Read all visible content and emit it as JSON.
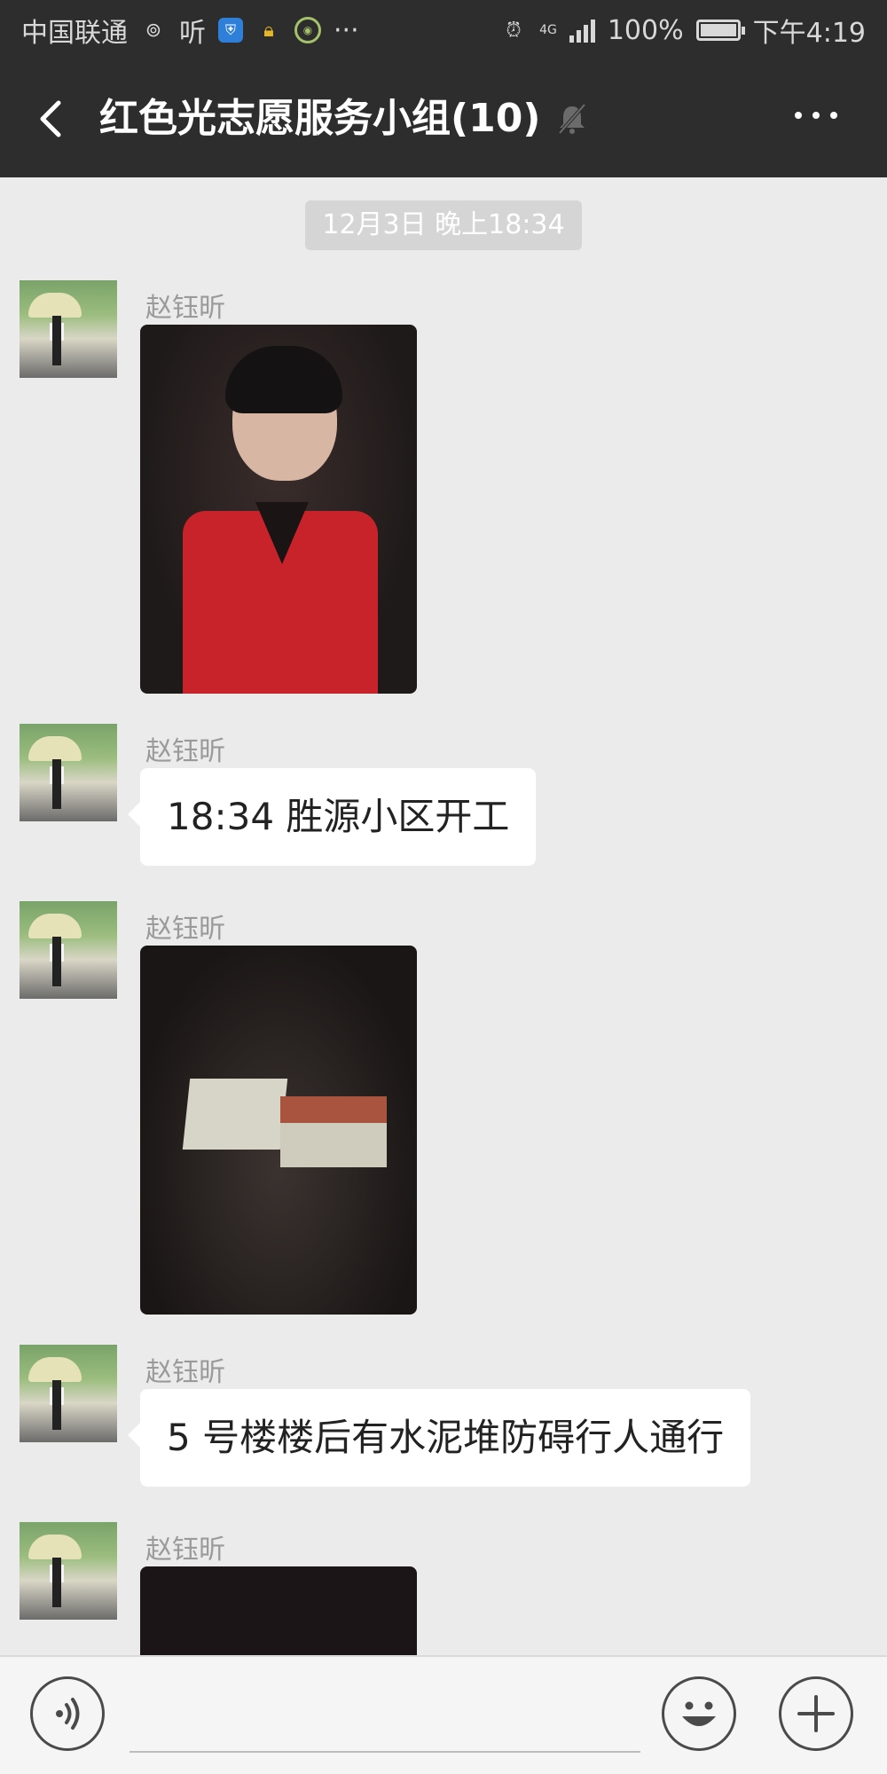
{
  "status_bar": {
    "carrier": "中国联通",
    "listen_label": "听",
    "overflow": "···",
    "network": "4G",
    "battery": "100%",
    "time": "下午4:19"
  },
  "header": {
    "back_icon": "chevron-left-icon",
    "title": "红色光志愿服务小组(10)",
    "muted_icon": "bell-off-icon",
    "more_icon": "more-icon"
  },
  "chat": {
    "timestamp": "12月3日 晚上18:34",
    "messages": [
      {
        "sender": "赵钰昕",
        "type": "image",
        "content": "portrait-photo"
      },
      {
        "sender": "赵钰昕",
        "type": "text",
        "content": "18:34 胜源小区开工"
      },
      {
        "sender": "赵钰昕",
        "type": "image",
        "content": "cement-pile-photo"
      },
      {
        "sender": "赵钰昕",
        "type": "text",
        "content": "5 号楼楼后有水泥堆防碍行人通行"
      },
      {
        "sender": "赵钰昕",
        "type": "image",
        "content": "night-building-photo"
      }
    ]
  },
  "input_bar": {
    "voice_icon": "voice-icon",
    "emoji_icon": "emoji-icon",
    "plus_icon": "plus-icon",
    "input_value": ""
  },
  "colors": {
    "header_bg": "#2d2d2d",
    "chat_bg": "#ebebeb",
    "bubble_bg": "#ffffff",
    "sender_text": "#9a9a9a"
  }
}
